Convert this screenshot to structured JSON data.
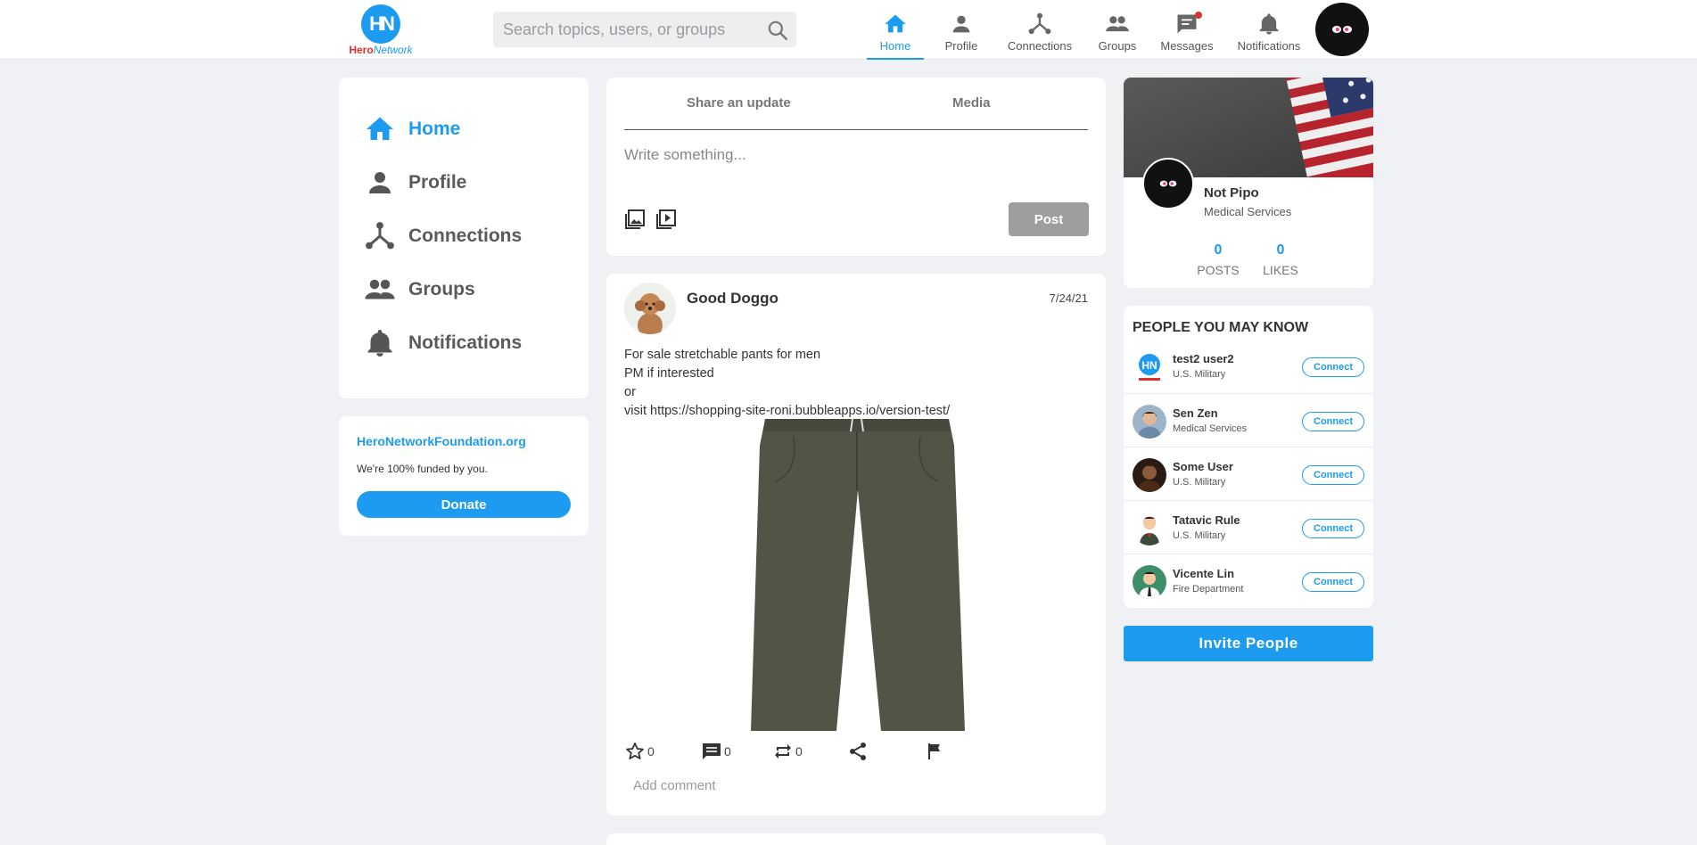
{
  "brand": {
    "logo_mark": "HN",
    "name_part1": "Hero",
    "name_part2": "Network"
  },
  "search": {
    "placeholder": "Search topics, users, or groups",
    "icon": "search-icon"
  },
  "topnav": [
    {
      "label": "Home",
      "icon": "home-icon",
      "active": true
    },
    {
      "label": "Profile",
      "icon": "person-icon"
    },
    {
      "label": "Connections",
      "icon": "connections-icon"
    },
    {
      "label": "Groups",
      "icon": "groups-icon"
    },
    {
      "label": "Messages",
      "icon": "messages-icon",
      "has_notification_dot": true
    },
    {
      "label": "Notifications",
      "icon": "bell-icon"
    }
  ],
  "sidebar": {
    "items": [
      {
        "label": "Home",
        "icon": "home-icon",
        "active": true
      },
      {
        "label": "Profile",
        "icon": "person-icon"
      },
      {
        "label": "Connections",
        "icon": "connections-icon"
      },
      {
        "label": "Groups",
        "icon": "groups-icon"
      },
      {
        "label": "Notifications",
        "icon": "bell-icon"
      }
    ]
  },
  "foundation": {
    "title": "HeroNetworkFoundation.org",
    "text": "We're 100% funded by you.",
    "donate_label": "Donate"
  },
  "composer": {
    "tab_update": "Share an update",
    "tab_media": "Media",
    "placeholder": "Write something...",
    "post_label": "Post"
  },
  "post": {
    "author": "Good Doggo",
    "date": "7/24/21",
    "text": "For sale stretchable pants for men\nPM if interested\nor\nvisit https://shopping-site-roni.bubbleapps.io/version-test/",
    "stars": "0",
    "comments": "0",
    "reposts": "0",
    "comment_placeholder": "Add comment"
  },
  "profile_card": {
    "name": "Not Pipo",
    "role": "Medical Services",
    "posts_count": "0",
    "posts_label": "POSTS",
    "likes_count": "0",
    "likes_label": "LIKES"
  },
  "pymk": {
    "title": "PEOPLE YOU MAY KNOW",
    "connect_label": "Connect",
    "people": [
      {
        "name": "test2 user2",
        "role": "U.S. Military"
      },
      {
        "name": "Sen Zen",
        "role": "Medical Services"
      },
      {
        "name": "Some User",
        "role": "U.S. Military"
      },
      {
        "name": "Tatavic Rule",
        "role": "U.S. Military"
      },
      {
        "name": "Vicente Lin",
        "role": "Fire Department"
      }
    ]
  },
  "invite_label": "Invite People",
  "colors": {
    "accent": "#1d9bf0",
    "background": "#f0f1f5",
    "post_button": "#9e9e9e"
  }
}
